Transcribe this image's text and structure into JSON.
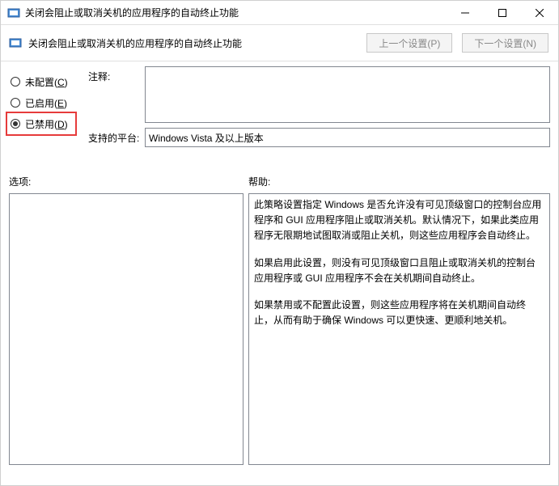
{
  "window": {
    "title": "关闭会阻止或取消关机的应用程序的自动终止功能"
  },
  "header": {
    "title": "关闭会阻止或取消关机的应用程序的自动终止功能",
    "prev_btn": "上一个设置(P)",
    "next_btn": "下一个设置(N)"
  },
  "radios": {
    "not_configured": "未配置(",
    "not_configured_key": "C",
    "enabled": "已启用(",
    "enabled_key": "E",
    "disabled": "已禁用(",
    "disabled_key": "D",
    "close": ")"
  },
  "fields": {
    "comment_label": "注释:",
    "platform_label": "支持的平台:",
    "platform_value": "Windows Vista 及以上版本"
  },
  "sections": {
    "options_label": "选项:",
    "help_label": "帮助:"
  },
  "help": {
    "p1": "此策略设置指定 Windows 是否允许没有可见顶级窗口的控制台应用程序和 GUI 应用程序阻止或取消关机。默认情况下，如果此类应用程序无限期地试图取消或阻止关机，则这些应用程序会自动终止。",
    "p2": "如果启用此设置，则没有可见顶级窗口且阻止或取消关机的控制台应用程序或 GUI 应用程序不会在关机期间自动终止。",
    "p3": "如果禁用或不配置此设置，则这些应用程序将在关机期间自动终止，从而有助于确保 Windows 可以更快速、更顺利地关机。"
  }
}
